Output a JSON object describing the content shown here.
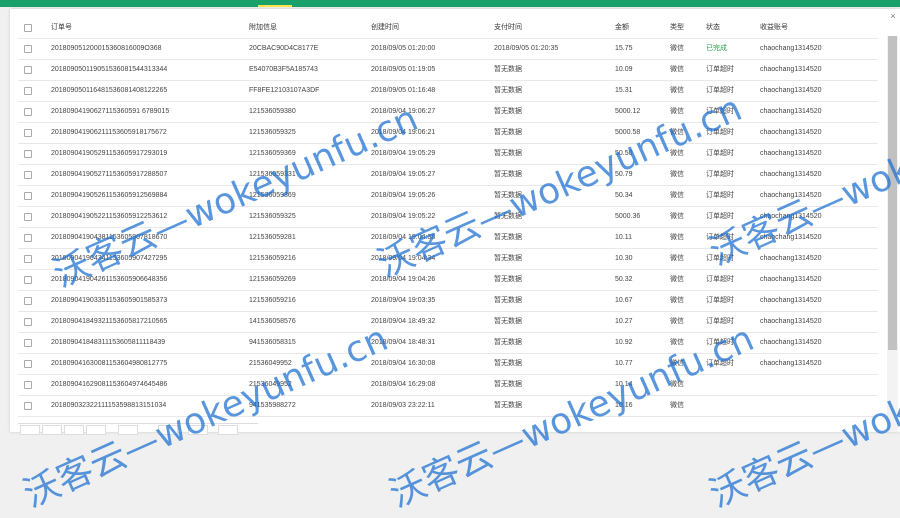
{
  "columns": {
    "order_no": "订单号",
    "attach": "附加信息",
    "created": "创建时间",
    "paid": "支付时间",
    "amount": "金额",
    "type": "类型",
    "status": "状态",
    "account": "收益账号"
  },
  "rows": [
    {
      "order_no": "201809051200015360816009O368",
      "attach": "20CBAC90D4C8177E",
      "created": "2018/09/05 01:20:00",
      "paid": "2018/09/05 01:20:35",
      "amount": "15.75",
      "type": "微信",
      "status": "已完成",
      "account": "chaochang1314520"
    },
    {
      "order_no": "201809050119051536081544313344",
      "attach": "E54070B3F5A185743",
      "created": "2018/09/05 01:19:05",
      "paid": "暂无数据",
      "amount": "10.09",
      "type": "微信",
      "status": "订单超时",
      "account": "chaochang1314520"
    },
    {
      "order_no": "201809050116481536081408122265",
      "attach": "FF8FE12103107A3DF",
      "created": "2018/09/05 01:16:48",
      "paid": "暂无数据",
      "amount": "15.31",
      "type": "微信",
      "status": "订单超时",
      "account": "chaochang1314520"
    },
    {
      "order_no": "20180904190627115360591 6789015",
      "attach": "121536059380",
      "created": "2018/09/04 19:06:27",
      "paid": "暂无数据",
      "amount": "5000.12",
      "type": "微信",
      "status": "订单超时",
      "account": "chaochang1314520"
    },
    {
      "order_no": "201809041906211153605918175672",
      "attach": "121536059325",
      "created": "2018/09/04 19:06:21",
      "paid": "暂无数据",
      "amount": "5000.58",
      "type": "微信",
      "status": "订单超时",
      "account": "chaochang1314520"
    },
    {
      "order_no": "201809041905291153605917293019",
      "attach": "121536059369",
      "created": "2018/09/04 19:05:29",
      "paid": "暂无数据",
      "amount": "50.50",
      "type": "微信",
      "status": "订单超时",
      "account": "chaochang1314520"
    },
    {
      "order_no": "201809041905271153605917288507",
      "attach": "121536059331",
      "created": "2018/09/04 19:05:27",
      "paid": "暂无数据",
      "amount": "50.79",
      "type": "微信",
      "status": "订单超时",
      "account": "chaochang1314520"
    },
    {
      "order_no": "201809041905261153605912569884",
      "attach": "121536059369",
      "created": "2018/09/04 19:05:26",
      "paid": "暂无数据",
      "amount": "50.34",
      "type": "微信",
      "status": "订单超时",
      "account": "chaochang1314520"
    },
    {
      "order_no": "201809041905221153605912253612",
      "attach": "121536059325",
      "created": "2018/09/04 19:05:22",
      "paid": "暂无数据",
      "amount": "5000.36",
      "type": "微信",
      "status": "订单超时",
      "account": "chaochang1314520"
    },
    {
      "order_no": "201809041904381153605907818670",
      "attach": "121536059281",
      "created": "2018/09/04 19:04:38",
      "paid": "暂无数据",
      "amount": "10.11",
      "type": "微信",
      "status": "订单超时",
      "account": "chaochang1314520"
    },
    {
      "order_no": "201809041904341153605907427295",
      "attach": "121536059216",
      "created": "2018/09/04 19:04:34",
      "paid": "暂无数据",
      "amount": "10.30",
      "type": "微信",
      "status": "订单超时",
      "account": "chaochang1314520"
    },
    {
      "order_no": "201809041904261153605906648356",
      "attach": "121536059269",
      "created": "2018/09/04 19:04:26",
      "paid": "暂无数据",
      "amount": "50.32",
      "type": "微信",
      "status": "订单超时",
      "account": "chaochang1314520"
    },
    {
      "order_no": "201809041903351153605901585373",
      "attach": "121536059216",
      "created": "2018/09/04 19:03:35",
      "paid": "暂无数据",
      "amount": "10.67",
      "type": "微信",
      "status": "订单超时",
      "account": "chaochang1314520"
    },
    {
      "order_no": "201809041849321153605817210565",
      "attach": "141536058576",
      "created": "2018/09/04 18:49:32",
      "paid": "暂无数据",
      "amount": "10.27",
      "type": "微信",
      "status": "订单超时",
      "account": "chaochang1314520"
    },
    {
      "order_no": "201809041848311153605811118439",
      "attach": "941536058315",
      "created": "2018/09/04 18:48:31",
      "paid": "暂无数据",
      "amount": "10.92",
      "type": "微信",
      "status": "订单超时",
      "account": "chaochang1314520"
    },
    {
      "order_no": "201809041630081153604980812775",
      "attach": "21536049952",
      "created": "2018/09/04 16:30:08",
      "paid": "暂无数据",
      "amount": "10.77",
      "type": "微信",
      "status": "订单超时",
      "account": "chaochang1314520"
    },
    {
      "order_no": "201809041629081153604974645486",
      "attach": "21536049952",
      "created": "2018/09/04 16:29:08",
      "paid": "暂无数据",
      "amount": "10.14",
      "type": "微信",
      "status": "",
      "account": ""
    },
    {
      "order_no": "201809032322111153598813151034",
      "attach": "941535988272",
      "created": "2018/09/03 23:22:11",
      "paid": "暂无数据",
      "amount": "10.16",
      "type": "微信",
      "status": "",
      "account": ""
    }
  ],
  "close_icon": "×",
  "watermark_text": "沃客云—wokeyunfu.cn"
}
